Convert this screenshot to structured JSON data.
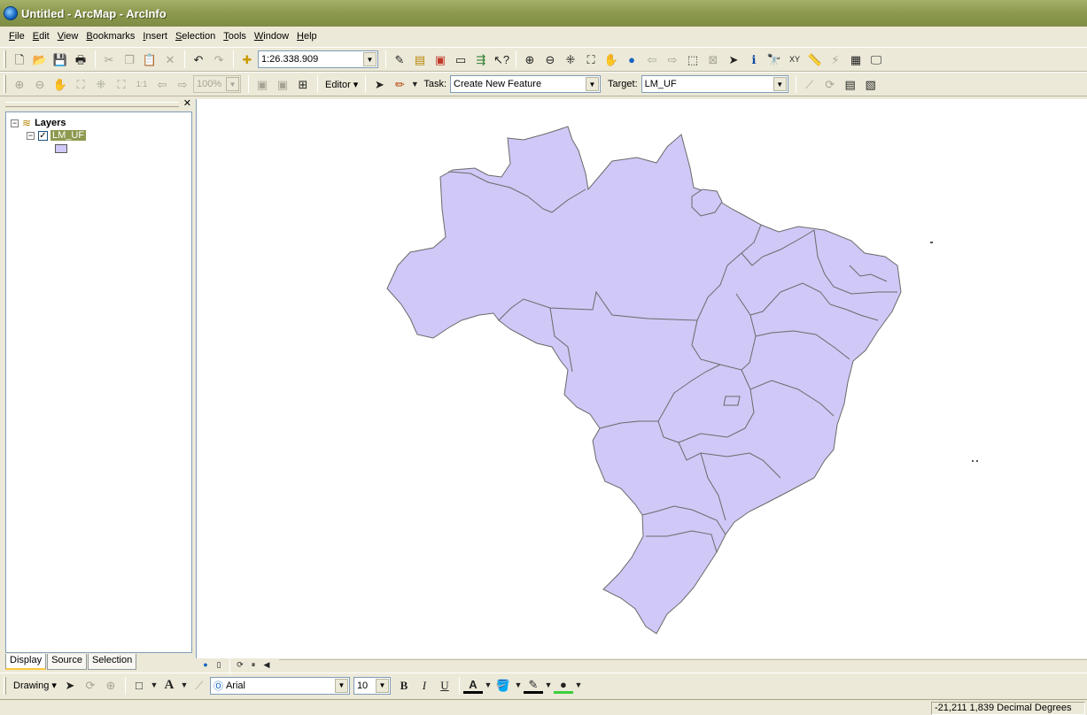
{
  "window": {
    "title": "Untitled - ArcMap - ArcInfo"
  },
  "menu": [
    "File",
    "Edit",
    "View",
    "Bookmarks",
    "Insert",
    "Selection",
    "Tools",
    "Window",
    "Help"
  ],
  "standard_toolbar": {
    "scale": "1:26.338.909"
  },
  "editor_toolbar": {
    "zoom_percent": "100%",
    "editor_label": "Editor",
    "task_label": "Task:",
    "task_value": "Create New Feature",
    "target_label": "Target:",
    "target_value": "LM_UF"
  },
  "toc": {
    "root_label": "Layers",
    "layer_name": "LM_UF",
    "layer_checked": true,
    "tabs": [
      "Display",
      "Source",
      "Selection"
    ]
  },
  "map": {
    "fill_color": "#d0c8f7",
    "stroke_color": "#6a6a6a"
  },
  "drawing_toolbar": {
    "drawing_label": "Drawing",
    "font_name": "Arial",
    "font_size": "10"
  },
  "status": {
    "coordinates": "-21,211  1,839 Decimal Degrees"
  }
}
